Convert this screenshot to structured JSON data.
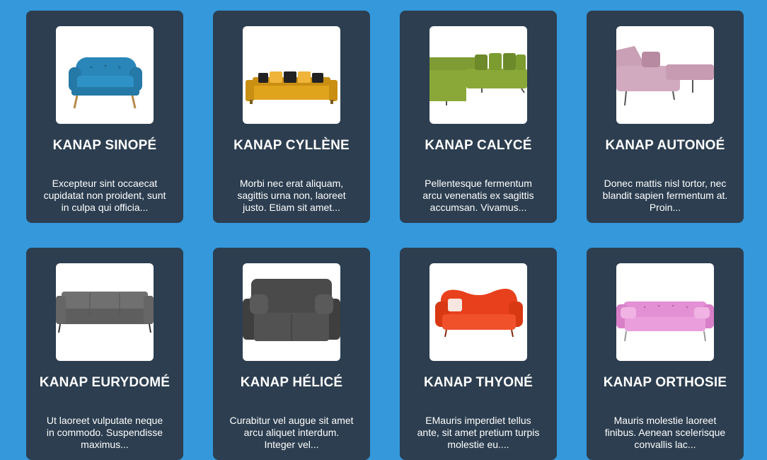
{
  "products": [
    {
      "name": "KANAP SINOPÉ",
      "description": "Excepteur sint occaecat cupidatat non proident, sunt in culpa qui officia...",
      "image_icon": "blue-sofa-image",
      "sofa_color": "#2a86b8"
    },
    {
      "name": "KANAP CYLLÈNE",
      "description": "Morbi nec erat aliquam, sagittis urna non, laoreet justo. Etiam sit amet...",
      "image_icon": "yellow-sofa-image",
      "sofa_color": "#e0a31c"
    },
    {
      "name": "KANAP CALYCÉ",
      "description": "Pellentesque fermentum arcu venenatis ex sagittis accumsan. Vivamus...",
      "image_icon": "green-corner-sofa-image",
      "sofa_color": "#8aa838"
    },
    {
      "name": "KANAP AUTONOÉ",
      "description": "Donec mattis nisl tortor, nec blandit sapien fermentum at. Proin...",
      "image_icon": "pink-chaise-sofa-image",
      "sofa_color": "#c9a0b6"
    },
    {
      "name": "KANAP EURYDOMÉ",
      "description": "Ut laoreet vulputate neque in commodo. Suspendisse maximus...",
      "image_icon": "gray-sofa-image",
      "sofa_color": "#6d6d6d"
    },
    {
      "name": "KANAP HÉLICÉ",
      "description": "Curabitur vel augue sit amet arcu aliquet interdum. Integer vel...",
      "image_icon": "dark-gray-loveseat-image",
      "sofa_color": "#4a4a4a"
    },
    {
      "name": "KANAP THYONÉ",
      "description": "EMauris imperdiet tellus ante, sit amet pretium turpis molestie eu....",
      "image_icon": "red-sofa-image",
      "sofa_color": "#e8401c"
    },
    {
      "name": "KANAP ORTHOSIE",
      "description": "Mauris molestie laoreet finibus. Aenean scelerisque convallis lac...",
      "image_icon": "pink-tufted-sofa-image",
      "sofa_color": "#e391d4"
    }
  ]
}
